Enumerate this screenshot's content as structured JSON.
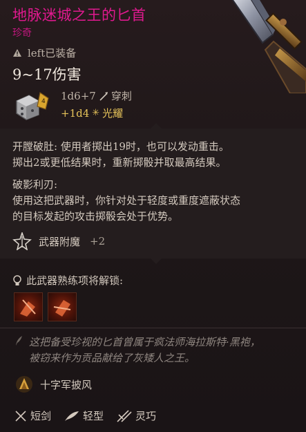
{
  "item": {
    "name": "地脉迷城之王的匕首",
    "rarity": "珍奇",
    "equip_status": "left已装备",
    "damage_range": "9~17伤害",
    "damage_dice": "1d6+7",
    "damage_type": "穿刺",
    "bonus_damage": "+1d4",
    "bonus_type": "光耀"
  },
  "abilities": {
    "ability1_name": "开膛破肚:",
    "ability1_line1": "使用者掷出19时，也可以发动重击。",
    "ability1_line2": "掷出2或更低结果时，重新掷骰并取最高结果。",
    "ability2_name": "破影利刃:",
    "ability2_line1": "使用这把武器时，你针对处于轻度或重度遮蔽状态",
    "ability2_line2": "的目标发起的攻击掷骰会处于优势。"
  },
  "enchant": {
    "label": "武器附魔",
    "value": "+2"
  },
  "mastery": {
    "header": "此武器熟练项将解锁:"
  },
  "lore": {
    "line1": "这把备受珍视的匕首曾属于疯法师海拉斯特·黑袍，",
    "line2": "被窃来作为贡品献给了灰矮人之王。"
  },
  "proficiency": {
    "label": "十字军披风"
  },
  "tags": {
    "t1": "短剑",
    "t2": "轻型",
    "t3": "灵巧"
  },
  "colors": {
    "title": "#e0198f",
    "rarity": "#c3177f",
    "bonus": "#e6c35a"
  }
}
